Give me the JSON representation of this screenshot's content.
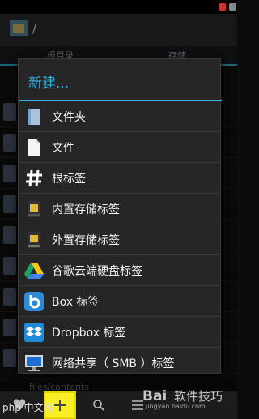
{
  "app": {
    "path": "/"
  },
  "tabs": [
    "根目录",
    "存储"
  ],
  "background": {
    "path_fragment": "files/contents"
  },
  "popup": {
    "title": "新建...",
    "items": [
      {
        "label": "文件夹",
        "icon": "folder-icon"
      },
      {
        "label": "文件",
        "icon": "file-icon"
      },
      {
        "label": "根标签",
        "icon": "hash-icon"
      },
      {
        "label": "内置存储标签",
        "icon": "sd-card-icon"
      },
      {
        "label": "外置存储标签",
        "icon": "sd-card-icon"
      },
      {
        "label": "谷歌云端硬盘标签",
        "icon": "google-drive-icon"
      },
      {
        "label": "Box 标签",
        "icon": "box-icon"
      },
      {
        "label": "Dropbox 标签",
        "icon": "dropbox-icon"
      },
      {
        "label": "网络共享（ SMB ）标签",
        "icon": "monitor-icon"
      }
    ]
  },
  "bottom_bar": {
    "buttons": [
      "bookmark-icon",
      "add-icon",
      "search-icon",
      "menu-icon"
    ],
    "active": "add-icon"
  },
  "watermark": {
    "text": "软件技巧",
    "sub": "jingyan.baidu.com",
    "logo": "Bai",
    "php": "php 中文网"
  },
  "colors": {
    "accent": "#33b5e5",
    "highlight": "#f8ef26",
    "menu_bg": "#262626"
  }
}
